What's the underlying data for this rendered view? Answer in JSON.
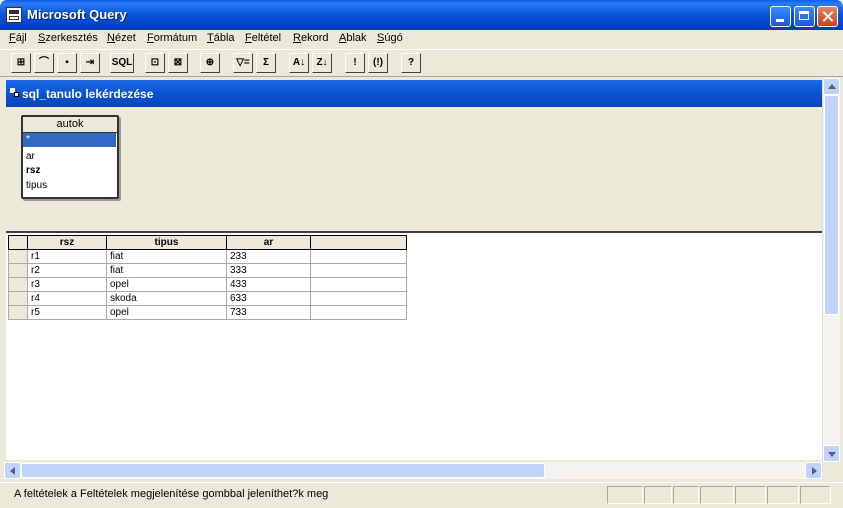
{
  "window": {
    "title": "Microsoft Query"
  },
  "menu": [
    {
      "mnemonic": "F",
      "rest": "ájl"
    },
    {
      "mnemonic": "S",
      "rest": "zerkesztés"
    },
    {
      "mnemonic": "N",
      "rest": "ézet"
    },
    {
      "mnemonic": "F",
      "rest": "ormátum"
    },
    {
      "mnemonic": "T",
      "rest": "ábla"
    },
    {
      "mnemonic": "F",
      "rest": "eltétel"
    },
    {
      "mnemonic": "R",
      "rest": "ekord"
    },
    {
      "mnemonic": "A",
      "rest": "blak"
    },
    {
      "mnemonic": "S",
      "rest": "úgó"
    }
  ],
  "toolbar": {
    "buttons": [
      {
        "name": "new-query-icon",
        "glyph": "⊞"
      },
      {
        "name": "open-icon",
        "glyph": "⌒"
      },
      {
        "name": "save-icon",
        "glyph": "▪"
      },
      {
        "name": "return-data-icon",
        "glyph": "⇥"
      },
      {
        "name": "sql-icon",
        "glyph": "SQL"
      },
      {
        "name": "show-tables-icon",
        "glyph": "⊡"
      },
      {
        "name": "show-criteria-icon",
        "glyph": "⊠"
      },
      {
        "name": "add-tables-icon",
        "glyph": "⊕"
      },
      {
        "name": "criteria-equals-icon",
        "glyph": "▽="
      },
      {
        "name": "totals-icon",
        "glyph": "Σ"
      },
      {
        "name": "sort-ascending-icon",
        "glyph": "A↓"
      },
      {
        "name": "sort-descending-icon",
        "glyph": "Z↓"
      },
      {
        "name": "query-now-icon",
        "glyph": "!"
      },
      {
        "name": "auto-query-icon",
        "glyph": "(!)"
      },
      {
        "name": "help-icon",
        "glyph": "?"
      }
    ]
  },
  "query_window": {
    "title": "sql_tanulo lekérdezése",
    "table": {
      "name": "autok",
      "fields": [
        "*",
        "ar",
        "rsz",
        "tipus"
      ],
      "selected": "*",
      "bold": "rsz"
    },
    "grid": {
      "columns": [
        "rsz",
        "tipus",
        "ar"
      ],
      "rows": [
        [
          "r1",
          "fiat",
          "233"
        ],
        [
          "r2",
          "fiat",
          "333"
        ],
        [
          "r3",
          "opel",
          "433"
        ],
        [
          "r4",
          "skoda",
          "633"
        ],
        [
          "r5",
          "opel",
          "733"
        ]
      ]
    }
  },
  "status": {
    "text": "A feltételek a Feltételek megjelenítése gombbal jeleníthet?k meg"
  }
}
